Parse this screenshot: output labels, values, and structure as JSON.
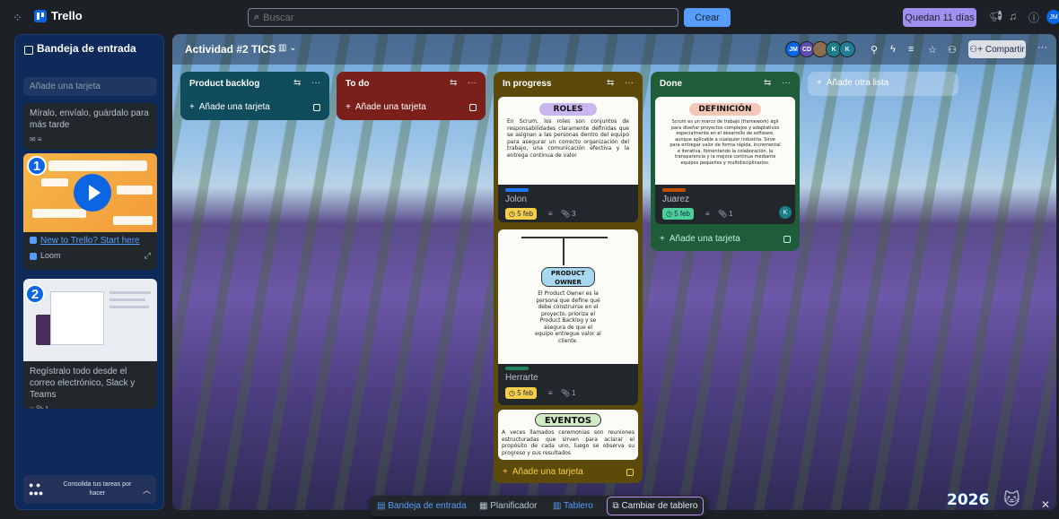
{
  "topbar": {
    "app_name": "Trello",
    "search_placeholder": "Buscar",
    "create_label": "Crear",
    "trial_label": "Quedan 11 días",
    "user_initials": "JM"
  },
  "inbox": {
    "title": "Bandeja de entrada",
    "add_placeholder": "Añade una tarjeta",
    "card1_text": "Míralo, envíalo, guárdalo para más tarde",
    "tutorial1_number": "1",
    "tutorial1_link": "New to Trello? Start here",
    "tutorial1_source": "Loom",
    "tutorial2_number": "2",
    "card2_text": "Regístralo todo desde el correo electrónico, Slack y Teams",
    "card2_attachments": "1",
    "consolidate_text": "Consolida tus tareas por hacer"
  },
  "board": {
    "title": "Actividad #2 TICS",
    "members": [
      {
        "initials": "JM",
        "color": "#0c66e4"
      },
      {
        "initials": "CD",
        "color": "#5e4db2"
      },
      {
        "initials": "",
        "color": "#8c6d4f"
      },
      {
        "initials": "K",
        "color": "#1d7f8c"
      },
      {
        "initials": "K",
        "color": "#227d9b"
      }
    ],
    "share_label": "Compartir",
    "add_list_label": "Añade otra lista"
  },
  "lists": {
    "backlog": {
      "title": "Product backlog",
      "add_label": "Añade una tarjeta",
      "color": "#0f4c5c"
    },
    "todo": {
      "title": "To do",
      "add_label": "Añade una tarjeta",
      "color": "#7a1f1a"
    },
    "progress": {
      "title": "In progress",
      "add_label": "Añade una tarjeta",
      "color": "#5c4a0a",
      "cards": [
        {
          "image_title": "ROLES",
          "image_text": "En Scrum, los roles son conjuntos de responsabilidades claramente definidas que se asignan a las personas dentro del equipo para asegurar un correcto organización del trabajo, una comunicación efectiva y la entrega continua de valor",
          "title": "Jolon",
          "date": "5 feb",
          "attachments": "3"
        },
        {
          "image_title": "PRODUCT OWNER",
          "image_text": "El Product Owner es la persona que define qué debe construirse en el proyecto, prioriza el Product Backlog y se asegura de que el equipo entregue valor al cliente.",
          "title": "Herrarte",
          "date": "5 feb",
          "attachments": "1"
        },
        {
          "image_title": "EVENTOS",
          "image_text": "A veces llamados ceremonias son reuniones estructuradas que sirven para aclarar el propósito de cada uno, luego se observa su progreso y sus resultados"
        }
      ]
    },
    "done": {
      "title": "Done",
      "add_label": "Añade una tarjeta",
      "color": "#1f5c3a",
      "card": {
        "image_title": "DEFINICIÓN",
        "image_text": "Scrum es un marco de trabajo (framework) ágil para diseñar proyectos complejos y adaptativos especialmente en el desarrollo de software, aunque aplicable a cualquier industria. Sirve para entregar valor de forma rápida, incremental e iterativa, fomentando la colaboración, la transparencia y la mejora continua mediante equipos pequeños y multidisciplinarios.",
        "title": "Juarez",
        "date": "5 feb",
        "attachments": "1",
        "member": "K"
      }
    }
  },
  "bottom_nav": {
    "inbox": "Bandeja de entrada",
    "planner": "Planificador",
    "board": "Tablero",
    "switch": "Cambiar de tablero"
  },
  "promo": {
    "year": "2026"
  }
}
